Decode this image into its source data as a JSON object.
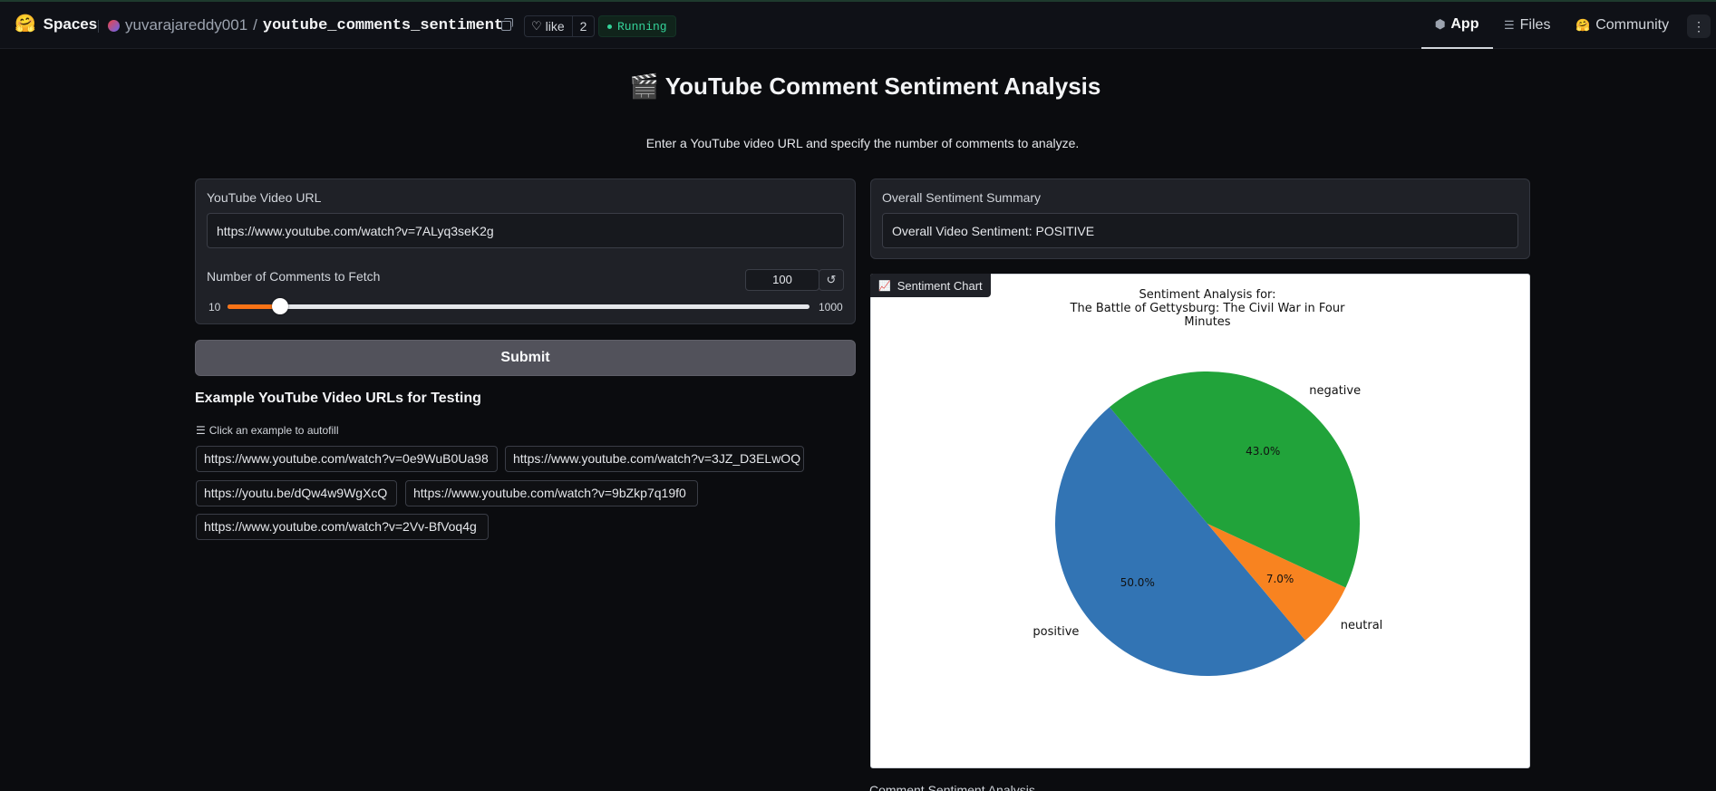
{
  "topbar": {
    "brand_emoji": "🤗",
    "brand_label": "Spaces",
    "owner": "yuvarajareddy001",
    "separator": "/",
    "repo_name": "youtube_comments_sentiment",
    "like_label": "like",
    "like_count": "2",
    "status": "Running",
    "nav": [
      {
        "label": "App",
        "icon": "cube-icon",
        "glyph": "⬢"
      },
      {
        "label": "Files",
        "icon": "files-icon",
        "glyph": "☰"
      },
      {
        "label": "Community",
        "icon": "community-icon",
        "glyph": "🤗"
      }
    ],
    "menu_glyph": "⋮"
  },
  "page": {
    "title": "🎬 YouTube Comment Sentiment Analysis",
    "subtitle": "Enter a YouTube video URL and specify the number of comments to analyze."
  },
  "form": {
    "url_label": "YouTube Video URL",
    "url_value": "https://www.youtube.com/watch?v=7ALyq3seK2g",
    "count_label": "Number of Comments to Fetch",
    "count_value": "100",
    "reset_glyph": "↺",
    "slider_min": "10",
    "slider_max": "1000",
    "slider_value": 100,
    "submit_label": "Submit"
  },
  "examples": {
    "heading": "Example YouTube Video URLs for Testing",
    "hint_icon": "☰",
    "hint": "Click an example to autofill",
    "items": [
      "https://www.youtube.com/watch?v=0e9WuB0Ua98",
      "https://www.youtube.com/watch?v=3JZ_D3ELwOQ",
      "https://youtu.be/dQw4w9WgXcQ",
      "https://www.youtube.com/watch?v=9bZkp7q19f0",
      "https://www.youtube.com/watch?v=2Vv-BfVoq4g"
    ]
  },
  "summary": {
    "label": "Overall Sentiment Summary",
    "value": "Overall Video Sentiment: POSITIVE"
  },
  "chart_panel": {
    "tag_icon": "📈",
    "tag_label": "Sentiment Chart",
    "below_label": "Comment Sentiment Analysis"
  },
  "chart_data": {
    "type": "pie",
    "title_lines": [
      "Sentiment Analysis for:",
      "The Battle of Gettysburg: The Civil War in Four",
      "Minutes"
    ],
    "slices": [
      {
        "label": "positive",
        "value": 50.0,
        "pct_label": "50.0%",
        "color": "#3274b4"
      },
      {
        "label": "neutral",
        "value": 7.0,
        "pct_label": "7.0%",
        "color": "#f88320"
      },
      {
        "label": "negative",
        "value": 43.0,
        "pct_label": "43.0%",
        "color": "#21a33a"
      }
    ],
    "start_angle_deg": 130,
    "direction": "counterclockwise"
  },
  "colors": {
    "accent_orange": "#f97316",
    "running_green": "#34d399"
  }
}
